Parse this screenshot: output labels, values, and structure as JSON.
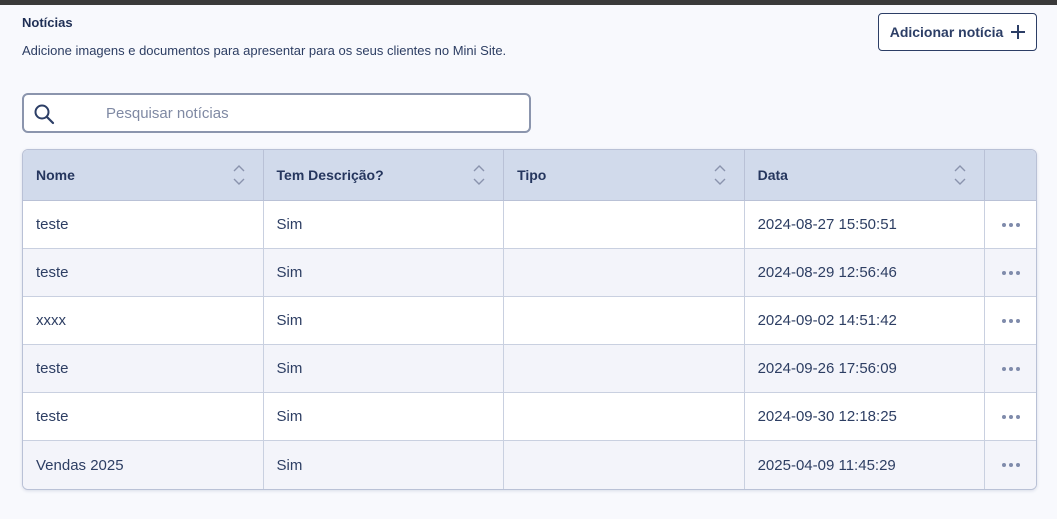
{
  "header": {
    "title": "Notícias",
    "subtitle": "Adicione imagens e documentos para apresentar para os seus clientes no Mini Site.",
    "add_button_label": "Adicionar notícia",
    "add_button_icon": "plus-icon"
  },
  "search": {
    "placeholder": "Pesquisar notícias",
    "value": "",
    "icon": "search-icon"
  },
  "table": {
    "columns": [
      {
        "label": "Nome",
        "sortable": true
      },
      {
        "label": "Tem Descrição?",
        "sortable": true
      },
      {
        "label": "Tipo",
        "sortable": true
      },
      {
        "label": "Data",
        "sortable": true
      },
      {
        "label": "",
        "sortable": false
      }
    ],
    "rows": [
      {
        "nome": "teste",
        "tem_descricao": "Sim",
        "tipo": "",
        "data": "2024-08-27 15:50:51"
      },
      {
        "nome": "teste",
        "tem_descricao": "Sim",
        "tipo": "",
        "data": "2024-08-29 12:56:46"
      },
      {
        "nome": "xxxx",
        "tem_descricao": "Sim",
        "tipo": "",
        "data": "2024-09-02 14:51:42"
      },
      {
        "nome": "teste",
        "tem_descricao": "Sim",
        "tipo": "",
        "data": "2024-09-26 17:56:09"
      },
      {
        "nome": "teste",
        "tem_descricao": "Sim",
        "tipo": "",
        "data": "2024-09-30 12:18:25"
      },
      {
        "nome": "Vendas 2025",
        "tem_descricao": "Sim",
        "tipo": "",
        "data": "2025-04-09 11:45:29"
      }
    ],
    "row_action_icon": "more-horizontal-icon"
  },
  "colors": {
    "header_bg": "#d1daeb",
    "alt_row_bg": "#f3f4fa",
    "text": "#2d3e63",
    "accent": "#2c3e66"
  }
}
